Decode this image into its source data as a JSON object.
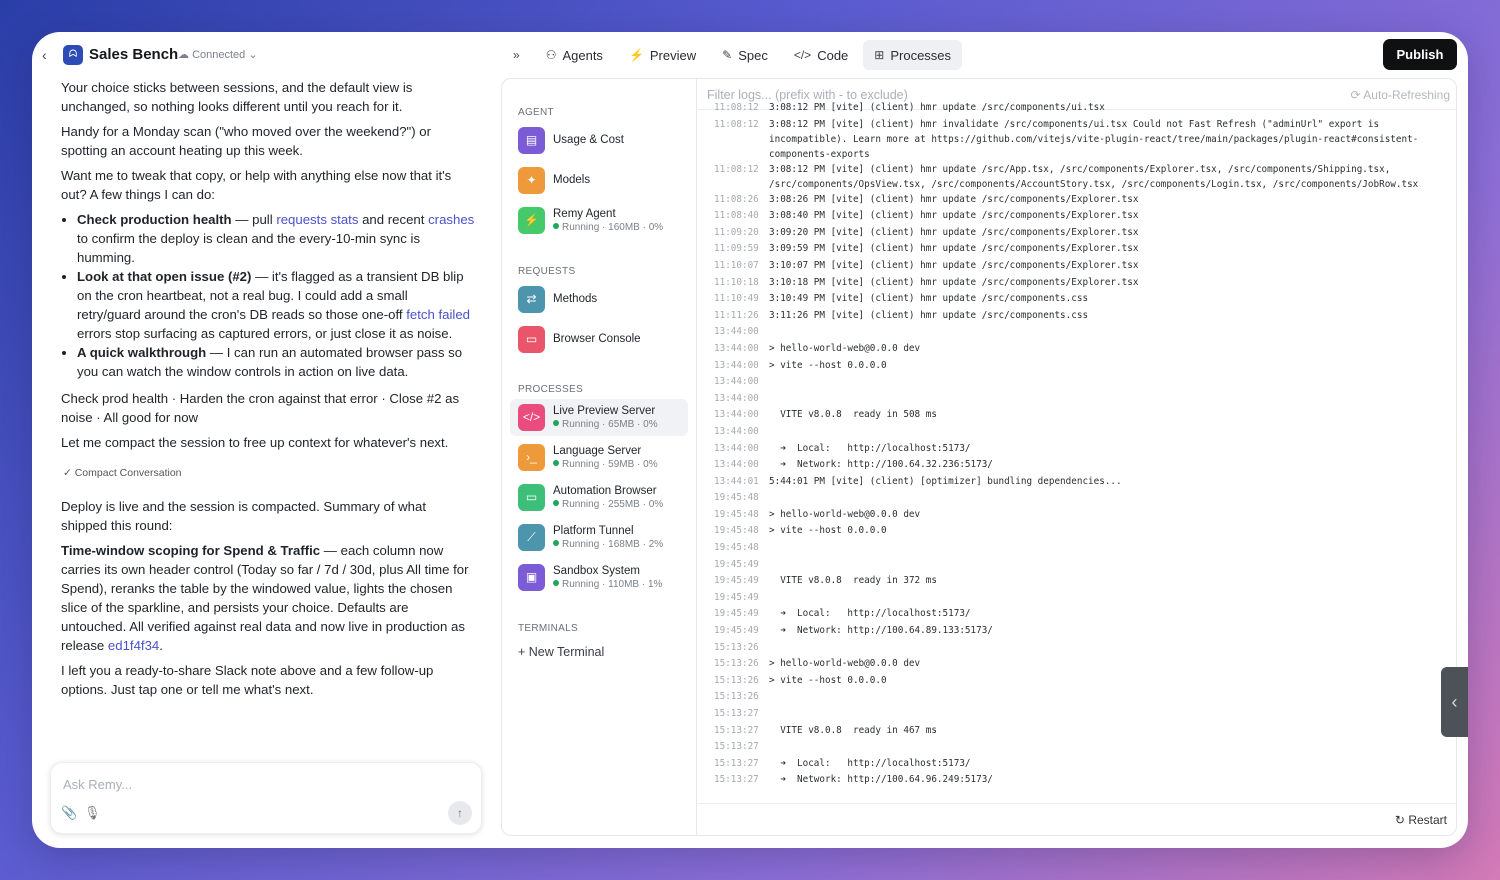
{
  "app": {
    "title": "Sales Bench",
    "status": "Connected",
    "publish": "Publish"
  },
  "nav": [
    {
      "icon": "»",
      "label": ""
    },
    {
      "icon": "⚇",
      "label": "Agents"
    },
    {
      "icon": "⚡",
      "label": "Preview"
    },
    {
      "icon": "✎",
      "label": "Spec"
    },
    {
      "icon": "</>",
      "label": "Code"
    },
    {
      "icon": "⊞",
      "label": "Processes"
    }
  ],
  "chat": {
    "p1": "Your choice sticks between sessions, and the default view is unchanged, so nothing looks different until you reach for it.",
    "p2": "Handy for a Monday scan (\"who moved over the weekend?\") or spotting an account heating up this week.",
    "p3": "Want me to tweak that copy, or help with anything else now that it's out? A few things I can do:",
    "b1_bold": "Check production health",
    "b1_a": " — pull ",
    "b1_link1": "requests stats",
    "b1_b": " and recent ",
    "b1_link2": "crashes",
    "b1_c": " to confirm the deploy is clean and the every-10-min sync is humming.",
    "b2_bold": "Look at that open issue (#2)",
    "b2_a": " — it's flagged as a transient DB blip on the cron heartbeat, not a real bug. I could add a small retry/guard around the cron's DB reads so those one-off ",
    "b2_link": "fetch failed",
    "b2_b": " errors stop surfacing as captured errors, or just close it as noise.",
    "b3_bold": "A quick walkthrough",
    "b3_a": " — I can run an automated browser pass so you can watch the window controls in action on live data.",
    "options": "Check prod health · Harden the cron against that error · Close #2 as noise · All good for now",
    "p4": "Let me compact the session to free up context for whatever's next.",
    "compact": "Compact Conversation",
    "p5": "Deploy is live and the session is compacted. Summary of what shipped this round:",
    "p6_bold": "Time-window scoping for Spend & Traffic",
    "p6_a": " — each column now carries its own header control (Today so far / 7d / 30d, plus All time for Spend), reranks the table by the windowed value, lights the chosen slice of the sparkline, and persists your choice. Defaults are untouched. All verified against real data and now live in production as release ",
    "p6_link": "ed1f4f34",
    "p6_b": ".",
    "p7": "I left you a ready-to-share Slack note above and a few follow-up options. Just tap one or tell me what's next.",
    "input_placeholder": "Ask Remy..."
  },
  "sidebar": {
    "agent_header": "AGENT",
    "requests_header": "REQUESTS",
    "processes_header": "PROCESSES",
    "terminals_header": "TERMINALS",
    "new_terminal": "New Terminal",
    "agent": [
      {
        "name": "Usage & Cost",
        "color": "#7b5cd6",
        "icon": "▤"
      },
      {
        "name": "Models",
        "color": "#ee9a3a",
        "icon": "✦"
      },
      {
        "name": "Remy Agent",
        "status": "Running · 160MB · 0%",
        "color": "#46c96a",
        "icon": "⚡"
      }
    ],
    "requests": [
      {
        "name": "Methods",
        "color": "#4c95ad",
        "icon": "⇄"
      },
      {
        "name": "Browser Console",
        "color": "#e9566b",
        "icon": "▭"
      }
    ],
    "processes": [
      {
        "name": "Live Preview Server",
        "status": "Running · 65MB · 0%",
        "color": "#ea4d7d",
        "icon": "</>"
      },
      {
        "name": "Language Server",
        "status": "Running · 59MB · 0%",
        "color": "#ee9a3a",
        "icon": "›_"
      },
      {
        "name": "Automation Browser",
        "status": "Running · 255MB · 0%",
        "color": "#3dbf79",
        "icon": "▭"
      },
      {
        "name": "Platform Tunnel",
        "status": "Running · 168MB · 2%",
        "color": "#4c95ad",
        "icon": "⟋"
      },
      {
        "name": "Sandbox System",
        "status": "Running · 110MB · 1%",
        "color": "#7b5cd6",
        "icon": "▣"
      }
    ]
  },
  "logs": {
    "filter_placeholder": "Filter logs... (prefix with - to exclude)",
    "auto_refresh": "Auto-Refreshing",
    "restart": "Restart",
    "lines": [
      {
        "t": "11:08:12",
        "m": "3:08:12 PM [vite] (client) hmr update /src/components/ui.tsx"
      },
      {
        "t": "11:08:12",
        "m": "3:08:12 PM [vite] (client) hmr invalidate /src/components/ui.tsx Could not Fast Refresh (\"adminUrl\" export is incompatible). Learn more at https://github.com/vitejs/vite-plugin-react/tree/main/packages/plugin-react#consistent-components-exports",
        "w": true
      },
      {
        "t": "11:08:12",
        "m": "3:08:12 PM [vite] (client) hmr update /src/App.tsx, /src/components/Explorer.tsx, /src/components/Shipping.tsx, /src/components/OpsView.tsx, /src/components/AccountStory.tsx, /src/components/Login.tsx, /src/components/JobRow.tsx",
        "w": true
      },
      {
        "t": "11:08:26",
        "m": "3:08:26 PM [vite] (client) hmr update /src/components/Explorer.tsx"
      },
      {
        "t": "11:08:40",
        "m": "3:08:40 PM [vite] (client) hmr update /src/components/Explorer.tsx"
      },
      {
        "t": "11:09:20",
        "m": "3:09:20 PM [vite] (client) hmr update /src/components/Explorer.tsx"
      },
      {
        "t": "11:09:59",
        "m": "3:09:59 PM [vite] (client) hmr update /src/components/Explorer.tsx"
      },
      {
        "t": "11:10:07",
        "m": "3:10:07 PM [vite] (client) hmr update /src/components/Explorer.tsx"
      },
      {
        "t": "11:10:18",
        "m": "3:10:18 PM [vite] (client) hmr update /src/components/Explorer.tsx"
      },
      {
        "t": "11:10:49",
        "m": "3:10:49 PM [vite] (client) hmr update /src/components.css"
      },
      {
        "t": "11:11:26",
        "m": "3:11:26 PM [vite] (client) hmr update /src/components.css"
      },
      {
        "t": "13:44:00",
        "m": ""
      },
      {
        "t": "13:44:00",
        "m": "> hello-world-web@0.0.0 dev"
      },
      {
        "t": "13:44:00",
        "m": "> vite --host 0.0.0.0"
      },
      {
        "t": "13:44:00",
        "m": ""
      },
      {
        "t": "13:44:00",
        "m": ""
      },
      {
        "t": "13:44:00",
        "m": "  VITE v8.0.8  ready in 508 ms"
      },
      {
        "t": "13:44:00",
        "m": ""
      },
      {
        "t": "13:44:00",
        "m": "  ➜  Local:   http://localhost:5173/"
      },
      {
        "t": "13:44:00",
        "m": "  ➜  Network: http://100.64.32.236:5173/"
      },
      {
        "t": "13:44:01",
        "m": "5:44:01 PM [vite] (client) [optimizer] bundling dependencies..."
      },
      {
        "t": "19:45:48",
        "m": ""
      },
      {
        "t": "19:45:48",
        "m": "> hello-world-web@0.0.0 dev"
      },
      {
        "t": "19:45:48",
        "m": "> vite --host 0.0.0.0"
      },
      {
        "t": "19:45:48",
        "m": ""
      },
      {
        "t": "19:45:49",
        "m": ""
      },
      {
        "t": "19:45:49",
        "m": "  VITE v8.0.8  ready in 372 ms"
      },
      {
        "t": "19:45:49",
        "m": ""
      },
      {
        "t": "19:45:49",
        "m": "  ➜  Local:   http://localhost:5173/"
      },
      {
        "t": "19:45:49",
        "m": "  ➜  Network: http://100.64.89.133:5173/"
      },
      {
        "t": "15:13:26",
        "m": ""
      },
      {
        "t": "15:13:26",
        "m": "> hello-world-web@0.0.0 dev"
      },
      {
        "t": "15:13:26",
        "m": "> vite --host 0.0.0.0"
      },
      {
        "t": "15:13:26",
        "m": ""
      },
      {
        "t": "15:13:27",
        "m": ""
      },
      {
        "t": "15:13:27",
        "m": "  VITE v8.0.8  ready in 467 ms"
      },
      {
        "t": "15:13:27",
        "m": ""
      },
      {
        "t": "15:13:27",
        "m": "  ➜  Local:   http://localhost:5173/"
      },
      {
        "t": "15:13:27",
        "m": "  ➜  Network: http://100.64.96.249:5173/"
      }
    ]
  }
}
